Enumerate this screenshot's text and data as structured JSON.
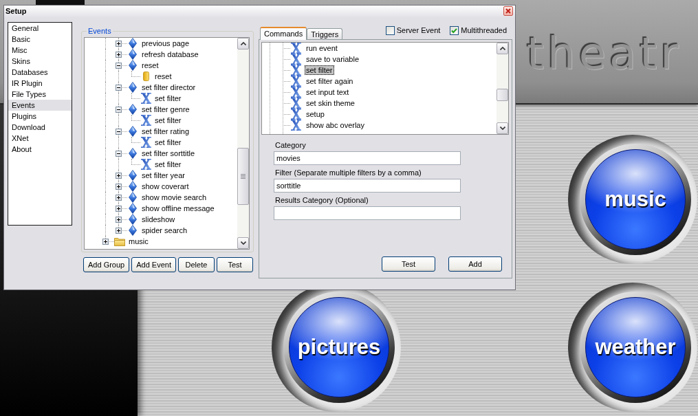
{
  "app": {
    "logo": "theatr",
    "buttons": [
      {
        "label": "music"
      },
      {
        "label": "pictures"
      },
      {
        "label": "weather"
      }
    ]
  },
  "dialog": {
    "title": "Setup",
    "sidebar": [
      {
        "label": "General",
        "selected": false
      },
      {
        "label": "Basic",
        "selected": false
      },
      {
        "label": "Misc",
        "selected": false
      },
      {
        "label": "Skins",
        "selected": false
      },
      {
        "label": "Databases",
        "selected": false
      },
      {
        "label": "IR Plugin",
        "selected": false
      },
      {
        "label": "File Types",
        "selected": false
      },
      {
        "label": "Events",
        "selected": true
      },
      {
        "label": "Plugins",
        "selected": false
      },
      {
        "label": "Download",
        "selected": false
      },
      {
        "label": "XNet",
        "selected": false
      },
      {
        "label": "About",
        "selected": false
      }
    ],
    "events": {
      "title": "Events",
      "tree": [
        {
          "children": [
            {
              "kind": "event",
              "label": "previous page",
              "expanded": false
            },
            {
              "kind": "event",
              "label": "refresh database",
              "expanded": false
            },
            {
              "kind": "event",
              "label": "reset",
              "expanded": true,
              "children": [
                {
                  "kind": "block",
                  "label": "reset"
                }
              ]
            },
            {
              "kind": "event",
              "label": "set filter director",
              "expanded": true,
              "children": [
                {
                  "kind": "command",
                  "label": "set filter"
                }
              ]
            },
            {
              "kind": "event",
              "label": "set filter genre",
              "expanded": true,
              "children": [
                {
                  "kind": "command",
                  "label": "set filter"
                }
              ]
            },
            {
              "kind": "event",
              "label": "set filter rating",
              "expanded": true,
              "children": [
                {
                  "kind": "command",
                  "label": "set filter"
                }
              ]
            },
            {
              "kind": "event",
              "label": "set filter sorttitle",
              "expanded": true,
              "children": [
                {
                  "kind": "command",
                  "label": "set filter"
                }
              ]
            },
            {
              "kind": "event",
              "label": "set filter year",
              "expanded": false
            },
            {
              "kind": "event",
              "label": "show coverart",
              "expanded": false
            },
            {
              "kind": "event",
              "label": "show movie search",
              "expanded": false
            },
            {
              "kind": "event",
              "label": "show offline message",
              "expanded": false
            },
            {
              "kind": "event",
              "label": "slideshow",
              "expanded": false
            },
            {
              "kind": "event",
              "label": "spider search",
              "expanded": false
            }
          ]
        },
        {
          "kind": "group",
          "label": "music",
          "expanded": false
        }
      ],
      "buttons": [
        "Add Group",
        "Add Event",
        "Delete",
        "Test"
      ]
    },
    "tabs": [
      {
        "label": "Commands",
        "selected": true
      },
      {
        "label": "Triggers",
        "selected": false
      }
    ],
    "options": [
      {
        "label": "Server Event",
        "checked": false
      },
      {
        "label": "Multithreaded",
        "checked": true
      }
    ],
    "commands": [
      {
        "label": "run event",
        "selected": false
      },
      {
        "label": "save to variable",
        "selected": false
      },
      {
        "label": "set filter",
        "selected": true
      },
      {
        "label": "set filter again",
        "selected": false
      },
      {
        "label": "set input text",
        "selected": false
      },
      {
        "label": "set skin theme",
        "selected": false
      },
      {
        "label": "setup",
        "selected": false
      },
      {
        "label": "show abc overlay",
        "selected": false
      }
    ],
    "fields": [
      {
        "label": "Category",
        "value": "movies"
      },
      {
        "label": "Filter (Separate multiple filters by a comma)",
        "value": "sorttitle"
      },
      {
        "label": "Results Category (Optional)"
      }
    ],
    "buttons": [
      "Test",
      "Add"
    ]
  }
}
